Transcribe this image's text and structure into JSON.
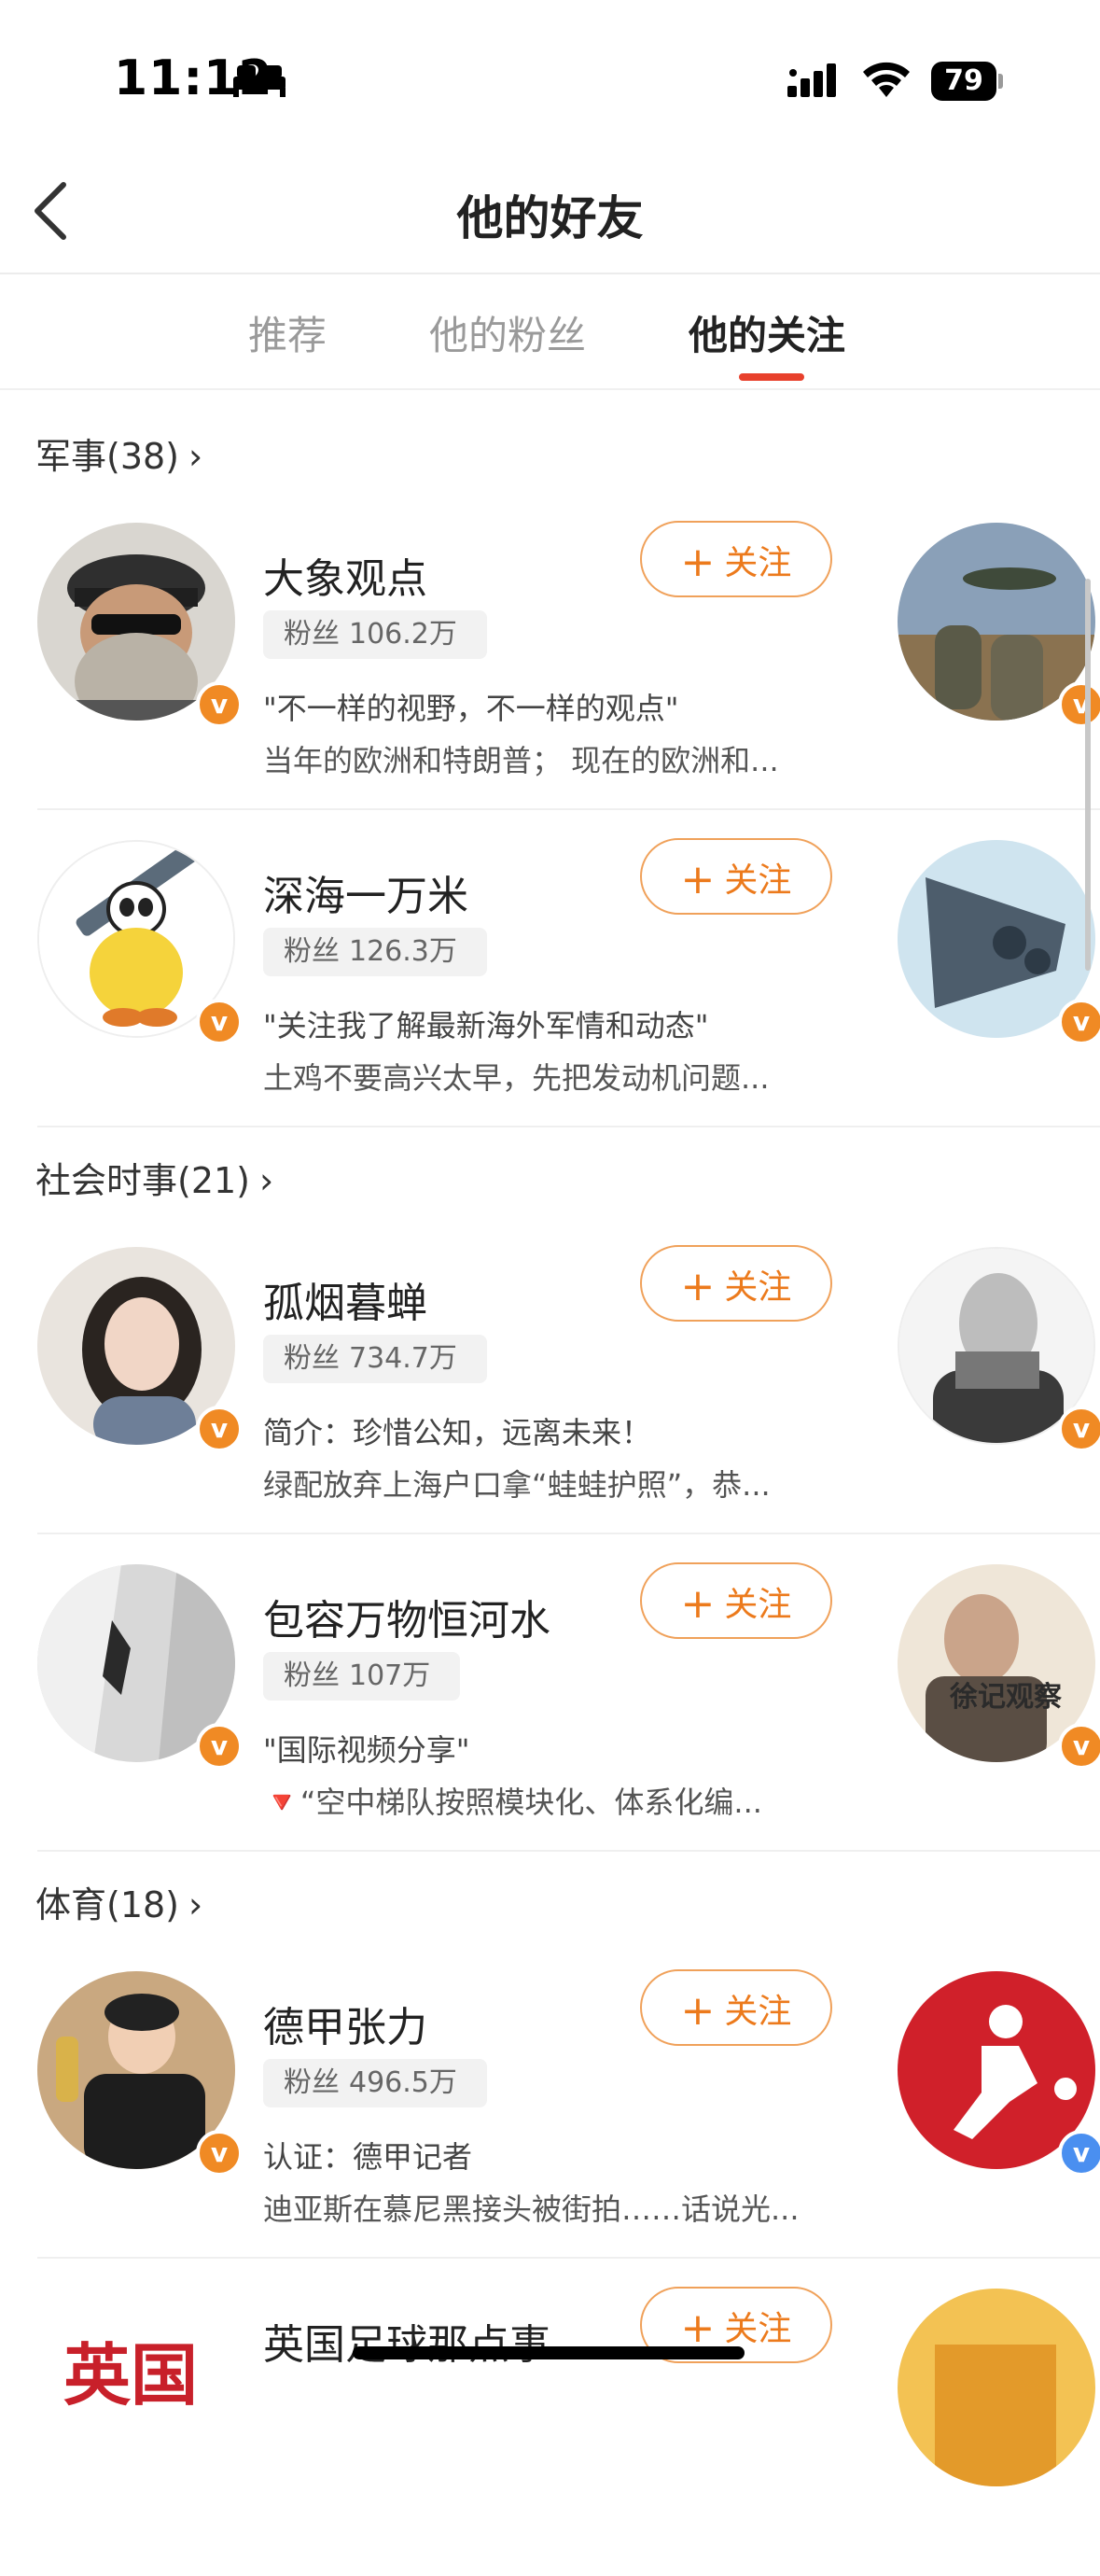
{
  "status_bar": {
    "time": "11:12",
    "battery": "79"
  },
  "nav": {
    "title": "他的好友"
  },
  "tabs": [
    {
      "label": "推荐"
    },
    {
      "label": "他的粉丝"
    },
    {
      "label": "他的关注"
    }
  ],
  "follow_label": "关注",
  "fans_label": "粉丝",
  "sections": [
    {
      "title": "军事(38)",
      "items": [
        {
          "name": "大象观点",
          "fans": "106.2万",
          "desc": "\"不一样的视野，不一样的观点\"",
          "latest": "当年的欧洲和特朗普； 现在的欧洲和..."
        },
        {
          "name": "深海一万米",
          "fans": "126.3万",
          "desc": "\"关注我了解最新海外军情和动态\"",
          "latest": "土鸡不要高兴太早，先把发动机问题..."
        }
      ]
    },
    {
      "title": "社会时事(21)",
      "items": [
        {
          "name": "孤烟暮蝉",
          "fans": "734.7万",
          "desc": "简介：珍惜公知，远离未来！",
          "latest": "绿配放弃上海户口拿“蛙蛙护照”，恭..."
        },
        {
          "name": "包容万物恒河水",
          "fans": "107万",
          "desc": "\"国际视频分享\"",
          "latest": "🔻“空中梯队按照模块化、体系化编...",
          "thumb_text": "徐记观察"
        }
      ]
    },
    {
      "title": "体育(18)",
      "items": [
        {
          "name": "德甲张力",
          "fans": "496.5万",
          "desc": "认证：德甲记者",
          "latest": "迪亚斯在慕尼黑接头被街拍……话说光..."
        },
        {
          "name": "英国足球那点事",
          "avatar_text": "英国"
        }
      ]
    }
  ],
  "colors": {
    "accent": "#e8402c",
    "follow": "#ec7a1c",
    "badge_orange": "#f08a24",
    "badge_blue": "#4a8ff0"
  }
}
